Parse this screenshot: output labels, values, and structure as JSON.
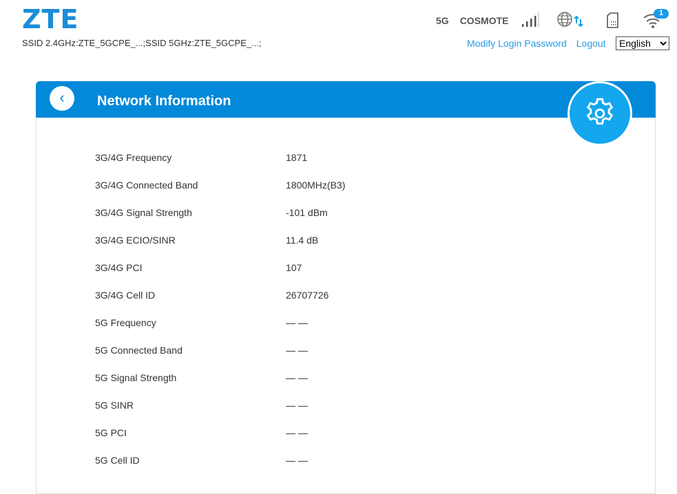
{
  "header": {
    "logo": "ZTE",
    "ssid": "SSID 2.4GHz:ZTE_5GCPE_...;SSID 5GHz:ZTE_5GCPE_...;",
    "network_type": "5G",
    "operator": "COSMOTE",
    "wifi_clients": "1",
    "modify_password": "Modify Login Password",
    "logout": "Logout",
    "language": "English"
  },
  "page": {
    "title": "Network Information"
  },
  "rows": [
    {
      "label": "3G/4G Frequency",
      "value": "1871"
    },
    {
      "label": "3G/4G Connected Band",
      "value": "1800MHz(B3)"
    },
    {
      "label": "3G/4G Signal Strength",
      "value": "-101 dBm"
    },
    {
      "label": "3G/4G ECIO/SINR",
      "value": "11.4 dB"
    },
    {
      "label": "3G/4G PCI",
      "value": "107"
    },
    {
      "label": "3G/4G Cell ID",
      "value": "26707726"
    },
    {
      "label": "5G Frequency",
      "value": "— —"
    },
    {
      "label": "5G Connected Band",
      "value": "— —"
    },
    {
      "label": "5G Signal Strength",
      "value": "— —"
    },
    {
      "label": "5G SINR",
      "value": "— —"
    },
    {
      "label": "5G PCI",
      "value": "— —"
    },
    {
      "label": "5G Cell ID",
      "value": "— —"
    }
  ]
}
